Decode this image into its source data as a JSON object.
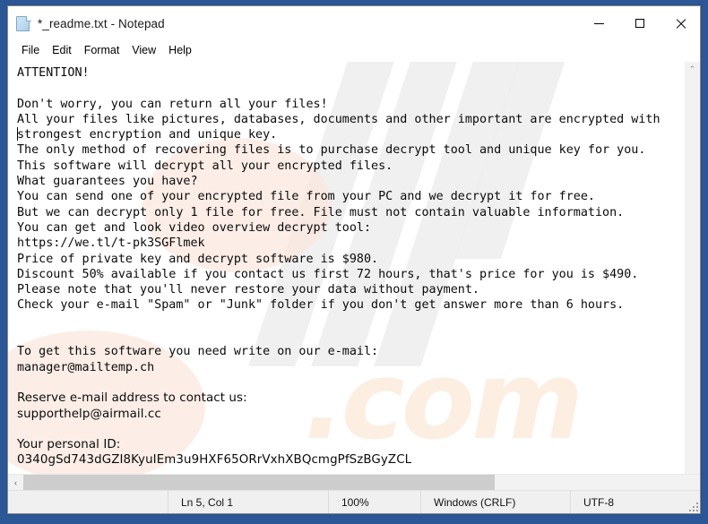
{
  "window": {
    "title": "*_readme.txt - Notepad",
    "icon": "notepad-document-icon",
    "controls": {
      "minimize": "–",
      "maximize": "□",
      "close": "✕"
    }
  },
  "menubar": {
    "items": [
      {
        "label": "File"
      },
      {
        "label": "Edit"
      },
      {
        "label": "Format"
      },
      {
        "label": "View"
      },
      {
        "label": "Help"
      }
    ]
  },
  "document": {
    "mono_text": "ATTENTION!\n\nDon't worry, you can return all your files!\nAll your files like pictures, databases, documents and other important are encrypted with\nstrongest encryption and unique key.\nThe only method of recovering files is to purchase decrypt tool and unique key for you.\nThis software will decrypt all your encrypted files.\nWhat guarantees you have?\nYou can send one of your encrypted file from your PC and we decrypt it for free.\nBut we can decrypt only 1 file for free. File must not contain valuable information.\nYou can get and look video overview decrypt tool:\nhttps://we.tl/t-pk3SGFlmek\nPrice of private key and decrypt software is $980.\nDiscount 50% available if you contact us first 72 hours, that's price for you is $490.\nPlease note that you'll never restore your data without payment.\nCheck your e-mail \"Spam\" or \"Junk\" folder if you don't get answer more than 6 hours.\n\n\nTo get this software you need write on our e-mail:\nmanager@mailtemp.ch\n",
    "prop_text": "\nReserve e-mail address to contact us:\nsupporthelp@airmail.cc\n\nYour personal ID:\n0340gSd743dGZI8KyuIEm3u9HXF65ORrVxhXBQcmgPfSzBGyZCL",
    "url": "https://we.tl/t-pk3SGFlmek",
    "primary_email": "manager@mailtemp.ch",
    "reserve_email": "supporthelp@airmail.cc",
    "personal_id": "0340gSd743dGZI8KyuIEm3u9HXF65ORrVxhXBQcmgPfSzBGyZCL",
    "price_full": "$980",
    "price_discount": "$490",
    "discount_percent": "50%",
    "discount_window_hours": "72",
    "answer_time_hours": "6"
  },
  "scrollbars": {
    "vertical_up_arrow": "⌃",
    "vertical_down_arrow": "⌄",
    "horizontal_left_arrow": "‹",
    "horizontal_right_arrow": "›"
  },
  "watermark": {
    "text": ".com"
  },
  "statusbar": {
    "line_col": "Ln 5, Col 1",
    "zoom": "100%",
    "line_ending": "Windows (CRLF)",
    "encoding": "UTF-8"
  },
  "colors": {
    "desktop": "#2b5797",
    "window_bg": "#ffffff",
    "statusbar_bg": "#f0f0f0",
    "scrollbar_thumb": "#cdcdcd",
    "text": "#0a0a0a",
    "watermark_com": "#fdeee2",
    "watermark_stripe": "#ededed"
  }
}
